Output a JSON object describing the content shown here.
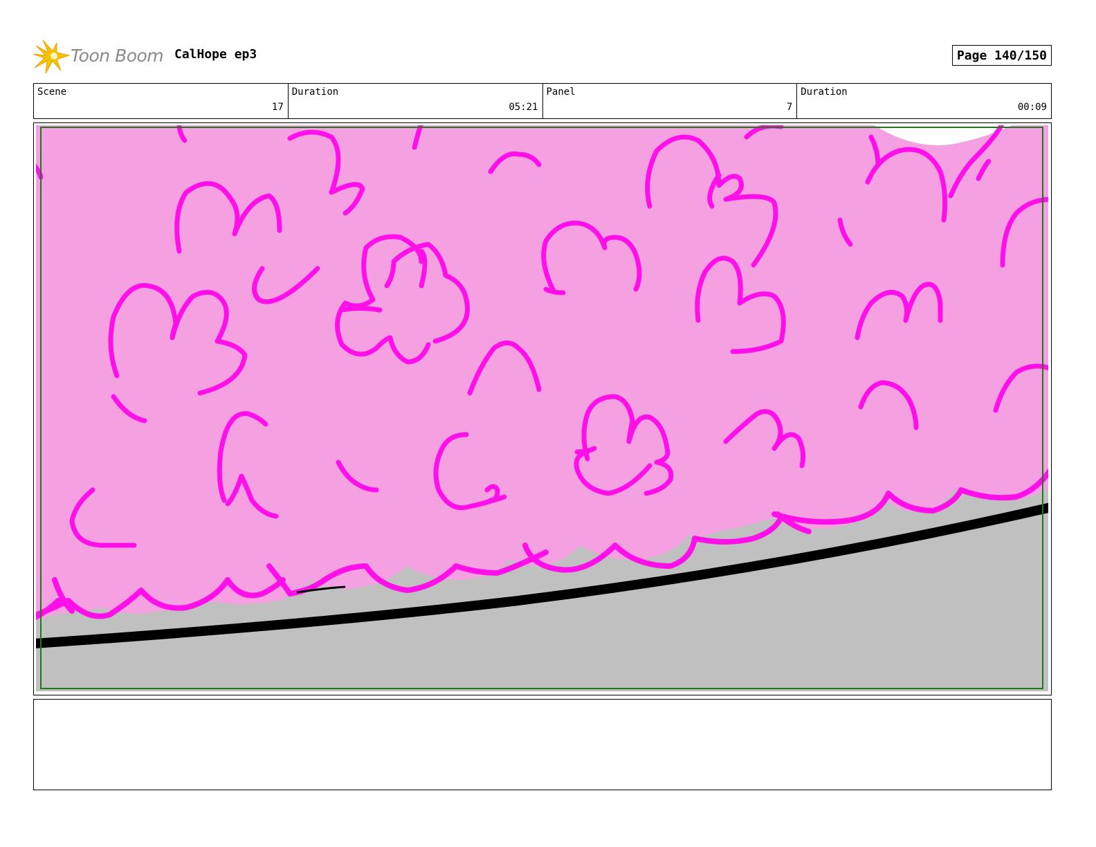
{
  "header": {
    "logo_text": "Toon Boom",
    "project_title": "CalHope ep3",
    "page_label": "Page 140/150"
  },
  "info": {
    "scene_label": "Scene",
    "scene_value": "17",
    "scene_duration_label": "Duration",
    "scene_duration_value": "05:21",
    "panel_label": "Panel",
    "panel_value": "7",
    "panel_duration_label": "Duration",
    "panel_duration_value": "00:09"
  },
  "colors": {
    "bush_fill": "#f5a0e0",
    "bush_line": "#ff10e8",
    "ground": "#c0c0c0",
    "safe_frame": "#1a7a1a",
    "logo_accent": "#f5c400"
  },
  "notes": {
    "text": ""
  }
}
